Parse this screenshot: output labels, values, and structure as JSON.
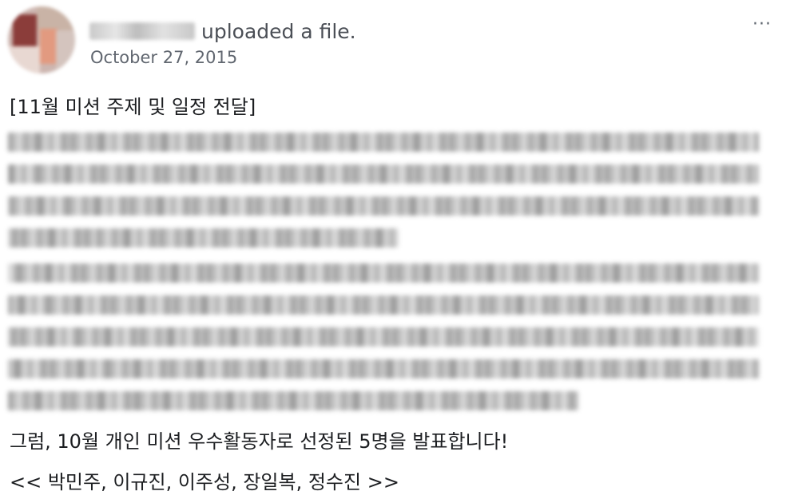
{
  "post": {
    "author_action": "uploaded a file.",
    "date": "October 27, 2015",
    "more_icon": "···",
    "title": "[11월 미션 주제 및 일정 전달]",
    "announcement": "그럼, 10월 개인 미션 우수활동자로 선정된 5명을 발표합니다!",
    "winners": "<< 박민주, 이규진, 이주성, 장일복, 정수진 >>"
  },
  "blurred_paragraphs": [
    {
      "lines": [
        1,
        1,
        1,
        0.52
      ]
    },
    {
      "lines": [
        1,
        1,
        1,
        1,
        0.76
      ]
    }
  ]
}
